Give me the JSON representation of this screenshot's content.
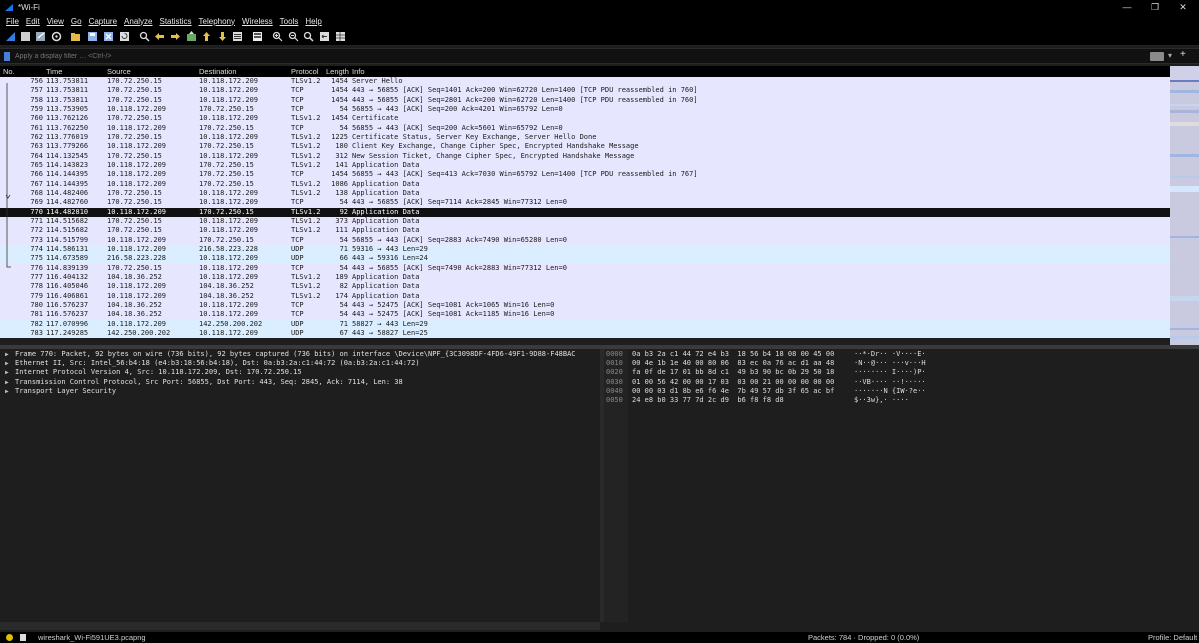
{
  "window": {
    "title": "*Wi-Fi",
    "minimize": "—",
    "maximize": "❐",
    "close": "✕"
  },
  "menu": [
    "File",
    "Edit",
    "View",
    "Go",
    "Capture",
    "Analyze",
    "Statistics",
    "Telephony",
    "Wireless",
    "Tools",
    "Help"
  ],
  "toolbar_icons": [
    "shark-fin-start-icon",
    "stop-icon",
    "restart-icon",
    "options-gear-icon",
    "open-folder-icon",
    "save-icon",
    "close-file-icon",
    "reload-icon",
    "find-icon",
    "back-arrow-icon",
    "forward-arrow-icon",
    "goto-packet-icon",
    "first-packet-icon",
    "last-packet-icon",
    "autoscroll-icon",
    "colorize-icon",
    "zoom-in-icon",
    "zoom-out-icon",
    "zoom-reset-icon",
    "resize-columns-icon",
    "layout-icon"
  ],
  "filter": {
    "placeholder": "Apply a display filter … <Ctrl-/>",
    "plus": "+",
    "dropdown": "▾"
  },
  "columns": {
    "no": "No.",
    "time": "Time",
    "source": "Source",
    "destination": "Destination",
    "protocol": "Protocol",
    "length": "Length",
    "info": "Info"
  },
  "packets": [
    {
      "no": "756",
      "time": "113.753811",
      "src": "170.72.250.15",
      "dst": "10.118.172.209",
      "proto": "TLSv1.2",
      "len": "1454",
      "info": "Server Hello",
      "kind": "tcp"
    },
    {
      "no": "757",
      "time": "113.753811",
      "src": "170.72.250.15",
      "dst": "10.118.172.209",
      "proto": "TCP",
      "len": "1454",
      "info": "443 → 56855 [ACK] Seq=1401 Ack=200 Win=62720 Len=1400 [TCP PDU reassembled in 760]",
      "kind": "tcp"
    },
    {
      "no": "758",
      "time": "113.753811",
      "src": "170.72.250.15",
      "dst": "10.118.172.209",
      "proto": "TCP",
      "len": "1454",
      "info": "443 → 56855 [ACK] Seq=2801 Ack=200 Win=62720 Len=1400 [TCP PDU reassembled in 760]",
      "kind": "tcp"
    },
    {
      "no": "759",
      "time": "113.753905",
      "src": "10.118.172.209",
      "dst": "170.72.250.15",
      "proto": "TCP",
      "len": "54",
      "info": "56855 → 443 [ACK] Seq=200 Ack=4201 Win=65792 Len=0",
      "kind": "tcp"
    },
    {
      "no": "760",
      "time": "113.762126",
      "src": "170.72.250.15",
      "dst": "10.118.172.209",
      "proto": "TLSv1.2",
      "len": "1454",
      "info": "Certificate",
      "kind": "tcp"
    },
    {
      "no": "761",
      "time": "113.762250",
      "src": "10.118.172.209",
      "dst": "170.72.250.15",
      "proto": "TCP",
      "len": "54",
      "info": "56855 → 443 [ACK] Seq=200 Ack=5601 Win=65792 Len=0",
      "kind": "tcp"
    },
    {
      "no": "762",
      "time": "113.776019",
      "src": "170.72.250.15",
      "dst": "10.118.172.209",
      "proto": "TLSv1.2",
      "len": "1225",
      "info": "Certificate Status, Server Key Exchange, Server Hello Done",
      "kind": "tcp"
    },
    {
      "no": "763",
      "time": "113.779266",
      "src": "10.118.172.209",
      "dst": "170.72.250.15",
      "proto": "TLSv1.2",
      "len": "180",
      "info": "Client Key Exchange, Change Cipher Spec, Encrypted Handshake Message",
      "kind": "tcp"
    },
    {
      "no": "764",
      "time": "114.132545",
      "src": "170.72.250.15",
      "dst": "10.118.172.209",
      "proto": "TLSv1.2",
      "len": "312",
      "info": "New Session Ticket, Change Cipher Spec, Encrypted Handshake Message",
      "kind": "tcp"
    },
    {
      "no": "765",
      "time": "114.143823",
      "src": "10.118.172.209",
      "dst": "170.72.250.15",
      "proto": "TLSv1.2",
      "len": "141",
      "info": "Application Data",
      "kind": "tcp"
    },
    {
      "no": "766",
      "time": "114.144395",
      "src": "10.118.172.209",
      "dst": "170.72.250.15",
      "proto": "TCP",
      "len": "1454",
      "info": "56855 → 443 [ACK] Seq=413 Ack=7030 Win=65792 Len=1400 [TCP PDU reassembled in 767]",
      "kind": "tcp"
    },
    {
      "no": "767",
      "time": "114.144395",
      "src": "10.118.172.209",
      "dst": "170.72.250.15",
      "proto": "TLSv1.2",
      "len": "1086",
      "info": "Application Data",
      "kind": "tcp"
    },
    {
      "no": "768",
      "time": "114.482406",
      "src": "170.72.250.15",
      "dst": "10.118.172.209",
      "proto": "TLSv1.2",
      "len": "138",
      "info": "Application Data",
      "kind": "tcp"
    },
    {
      "no": "769",
      "time": "114.482760",
      "src": "170.72.250.15",
      "dst": "10.118.172.209",
      "proto": "TCP",
      "len": "54",
      "info": "443 → 56855 [ACK] Seq=7114 Ack=2845 Win=77312 Len=0",
      "kind": "tcp"
    },
    {
      "no": "770",
      "time": "114.482810",
      "src": "10.118.172.209",
      "dst": "170.72.250.15",
      "proto": "TLSv1.2",
      "len": "92",
      "info": "Application Data",
      "kind": "sel"
    },
    {
      "no": "771",
      "time": "114.515682",
      "src": "170.72.250.15",
      "dst": "10.118.172.209",
      "proto": "TLSv1.2",
      "len": "373",
      "info": "Application Data",
      "kind": "tcp"
    },
    {
      "no": "772",
      "time": "114.515682",
      "src": "170.72.250.15",
      "dst": "10.118.172.209",
      "proto": "TLSv1.2",
      "len": "111",
      "info": "Application Data",
      "kind": "tcp"
    },
    {
      "no": "773",
      "time": "114.515799",
      "src": "10.118.172.209",
      "dst": "170.72.250.15",
      "proto": "TCP",
      "len": "54",
      "info": "56855 → 443 [ACK] Seq=2883 Ack=7490 Win=65280 Len=0",
      "kind": "tcp"
    },
    {
      "no": "774",
      "time": "114.586131",
      "src": "10.118.172.209",
      "dst": "216.58.223.228",
      "proto": "UDP",
      "len": "71",
      "info": "59316 → 443 Len=29",
      "kind": "udp"
    },
    {
      "no": "775",
      "time": "114.673589",
      "src": "216.58.223.228",
      "dst": "10.118.172.209",
      "proto": "UDP",
      "len": "66",
      "info": "443 → 59316 Len=24",
      "kind": "udp"
    },
    {
      "no": "776",
      "time": "114.839139",
      "src": "170.72.250.15",
      "dst": "10.118.172.209",
      "proto": "TCP",
      "len": "54",
      "info": "443 → 56855 [ACK] Seq=7490 Ack=2883 Win=77312 Len=0",
      "kind": "tcp"
    },
    {
      "no": "777",
      "time": "116.404132",
      "src": "104.18.36.252",
      "dst": "10.118.172.209",
      "proto": "TLSv1.2",
      "len": "189",
      "info": "Application Data",
      "kind": "tcp"
    },
    {
      "no": "778",
      "time": "116.405046",
      "src": "10.118.172.209",
      "dst": "104.18.36.252",
      "proto": "TLSv1.2",
      "len": "82",
      "info": "Application Data",
      "kind": "tcp"
    },
    {
      "no": "779",
      "time": "116.406861",
      "src": "10.118.172.209",
      "dst": "104.18.36.252",
      "proto": "TLSv1.2",
      "len": "174",
      "info": "Application Data",
      "kind": "tcp"
    },
    {
      "no": "780",
      "time": "116.576237",
      "src": "104.18.36.252",
      "dst": "10.118.172.209",
      "proto": "TCP",
      "len": "54",
      "info": "443 → 52475 [ACK] Seq=1081 Ack=1065 Win=16 Len=0",
      "kind": "tcp"
    },
    {
      "no": "781",
      "time": "116.576237",
      "src": "104.18.36.252",
      "dst": "10.118.172.209",
      "proto": "TCP",
      "len": "54",
      "info": "443 → 52475 [ACK] Seq=1081 Ack=1185 Win=16 Len=0",
      "kind": "tcp"
    },
    {
      "no": "782",
      "time": "117.070996",
      "src": "10.118.172.209",
      "dst": "142.250.200.202",
      "proto": "UDP",
      "len": "71",
      "info": "58827 → 443 Len=29",
      "kind": "udp"
    },
    {
      "no": "783",
      "time": "117.249285",
      "src": "142.250.200.202",
      "dst": "10.118.172.209",
      "proto": "UDP",
      "len": "67",
      "info": "443 → 58827 Len=25",
      "kind": "udp"
    }
  ],
  "details": [
    "Frame 770: Packet, 92 bytes on wire (736 bits), 92 bytes captured (736 bits) on interface \\Device\\NPF_{3C3098DF-4FD6-49F1-9D88-F48BAC",
    "Ethernet II, Src: Intel_56:b4:18 (e4:b3:18:56:b4:18), Dst: 0a:b3:2a:c1:44:72 (0a:b3:2a:c1:44:72)",
    "Internet Protocol Version 4, Src: 10.118.172.209, Dst: 170.72.250.15",
    "Transmission Control Protocol, Src Port: 56855, Dst Port: 443, Seq: 2845, Ack: 7114, Len: 38",
    "Transport Layer Security"
  ],
  "hex": [
    {
      "off": "0000",
      "hex": "0a b3 2a c1 44 72 e4 b3  18 56 b4 18 08 00 45 00",
      "ascii": "··*·Dr·· ·V····E·"
    },
    {
      "off": "0010",
      "hex": "00 4e 1b 1e 40 00 80 06  83 ec 0a 76 ac d1 aa 48",
      "ascii": "·N··@··· ···v···H"
    },
    {
      "off": "0020",
      "hex": "fa 0f de 17 01 bb 8d c1  49 b3 90 bc 0b 29 50 18",
      "ascii": "········ I····)P·"
    },
    {
      "off": "0030",
      "hex": "01 00 56 42 00 00 17 03  03 00 21 00 00 00 00 00",
      "ascii": "··VB···· ··!·····"
    },
    {
      "off": "0040",
      "hex": "00 00 03 d1 8b e6 f6 4e  7b 49 57 db 3f 65 ac bf",
      "ascii": "·······N {IW·?e··"
    },
    {
      "off": "0050",
      "hex": "24 e8 b0 33 77 7d 2c d9  b6 f8 f8 d8",
      "ascii": "$··3w},· ····"
    }
  ],
  "status": {
    "file": "wireshark_Wi-Fi591UE3.pcapng",
    "packets": "Packets: 784 · Dropped: 0 (0.0%)",
    "profile": "Profile: Default"
  }
}
